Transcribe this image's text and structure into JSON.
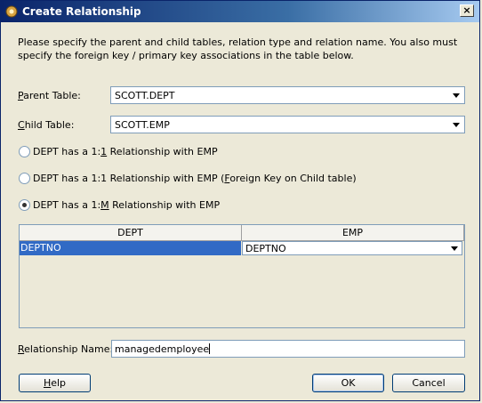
{
  "window": {
    "title": "Create Relationship",
    "close_glyph": "×"
  },
  "intro_text": "Please specify the parent and child tables, relation type and relation name.  You also must specify the foreign key / primary key associations in the table below.",
  "parent_table": {
    "label_mnemonic": "P",
    "label_rest": "arent Table:",
    "value": "SCOTT.DEPT"
  },
  "child_table": {
    "label_mnemonic": "C",
    "label_rest": "hild Table:",
    "value": "SCOTT.EMP"
  },
  "relationship_types": [
    {
      "pre": "DEPT has a 1:",
      "mn": "1",
      "post": " Relationship with EMP",
      "checked": false
    },
    {
      "pre": "DEPT has a 1:1 Relationship with EMP (",
      "mn": "F",
      "post": "oreign Key on Child table)",
      "checked": false
    },
    {
      "pre": "DEPT has a 1:",
      "mn": "M",
      "post": " Relationship with EMP",
      "checked": true
    }
  ],
  "key_table": {
    "columns": [
      "DEPT",
      "EMP"
    ],
    "rows": [
      {
        "parent_key": "DEPTNO",
        "child_key": "DEPTNO"
      }
    ]
  },
  "relationship_name": {
    "label_mnemonic": "R",
    "label_rest": "elationship Name:",
    "value": "managedemployee"
  },
  "buttons": {
    "help_mnemonic": "H",
    "help_rest": "elp",
    "ok": "OK",
    "cancel": "Cancel"
  },
  "colors": {
    "title_bar": "#0a246a",
    "selection": "#316ac5",
    "dialog_bg": "#ece9d8"
  }
}
